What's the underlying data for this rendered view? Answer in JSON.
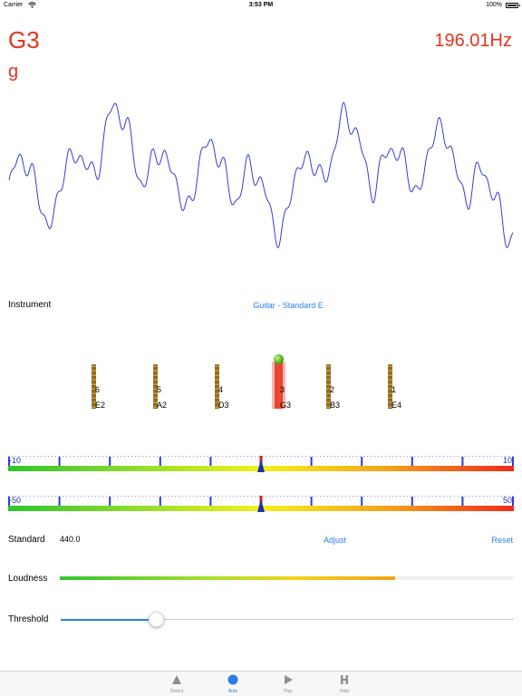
{
  "status_bar": {
    "carrier": "Carrier",
    "time": "3:53 PM",
    "battery": "100%"
  },
  "reading": {
    "note": "G3",
    "frequency": "196.01Hz",
    "note_lower": "g"
  },
  "instrument": {
    "label": "Instrument",
    "value": "Guitar - Standard E"
  },
  "strings": [
    {
      "number": "6",
      "note": "E2",
      "active": false
    },
    {
      "number": "5",
      "note": "A2",
      "active": false
    },
    {
      "number": "4",
      "note": "D3",
      "active": false
    },
    {
      "number": "3",
      "note": "G3",
      "active": true
    },
    {
      "number": "2",
      "note": "B3",
      "active": false
    },
    {
      "number": "1",
      "note": "E4",
      "active": false
    }
  ],
  "meter_fine": {
    "min_label": "-10",
    "max_label": "10",
    "min": -10,
    "max": 10,
    "value": 0
  },
  "meter_coarse": {
    "min_label": "-50",
    "max_label": "50",
    "min": -50,
    "max": 50,
    "value": 0
  },
  "standard": {
    "label": "Standard",
    "value": "440.0",
    "adjust": "Adjust",
    "reset": "Reset"
  },
  "loudness": {
    "label": "Loudness",
    "level": 0.74
  },
  "threshold": {
    "label": "Threshold",
    "level": 0.21
  },
  "tabs": [
    {
      "label": "Detect",
      "icon": "triangle-icon",
      "active": false
    },
    {
      "label": "Auto",
      "icon": "circle-icon",
      "active": true
    },
    {
      "label": "Play",
      "icon": "play-icon",
      "active": false
    },
    {
      "label": "Help",
      "icon": "help-h-icon",
      "active": false
    }
  ],
  "colors": {
    "accent": "#2b7de9",
    "reading": "#e8321e",
    "waveform": "#3a3ad8",
    "meter_marker": "#1f2fb0"
  }
}
